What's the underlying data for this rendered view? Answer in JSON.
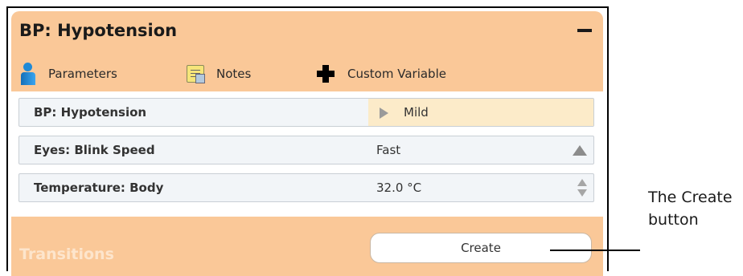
{
  "panel": {
    "title": "BP: Hypotension",
    "collapse_icon": "minus-icon",
    "toolbar": {
      "parameters_label": "Parameters",
      "parameters_icon": "person-icon",
      "notes_label": "Notes",
      "notes_icon": "notes-icon",
      "custom_variable_label": "Custom Variable",
      "custom_variable_icon": "plus-icon"
    },
    "rows": [
      {
        "name": "BP: Hypotension",
        "value": "Mild",
        "control_icon": "play-icon"
      },
      {
        "name": "Eyes: Blink Speed",
        "value": "Fast",
        "control_icon": "triangle-up-icon"
      },
      {
        "name": "Temperature: Body",
        "value": "32.0 °C",
        "control_icon": "stepper-icon"
      }
    ],
    "transitions_label": "Transitions",
    "create_label": "Create"
  },
  "annotation": {
    "text": "The Create button"
  },
  "colors": {
    "panel_bg": "#fac898",
    "row_bg": "#f2f5f8",
    "selected_value_bg": "#fcebc9",
    "transitions_text": "#fde5cc"
  }
}
